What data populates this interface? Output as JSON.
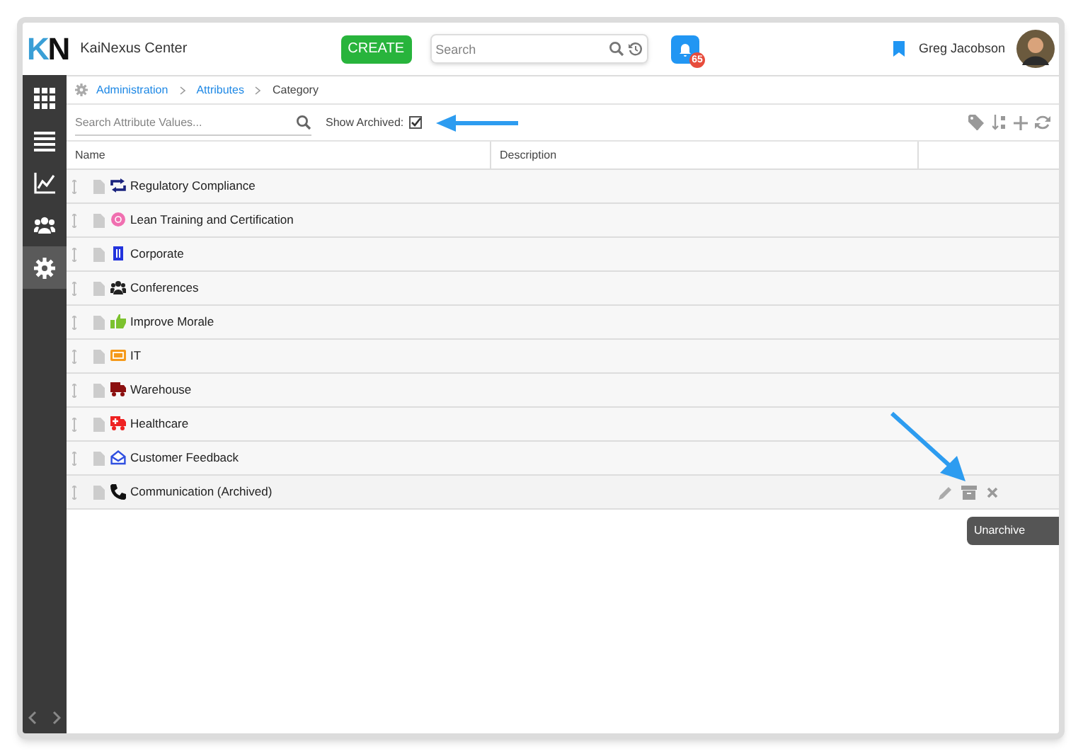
{
  "header": {
    "logo": "KN",
    "app_title": "KaiNexus Center",
    "create_button": "CREATE",
    "search": {
      "placeholder": "Search"
    },
    "notifications": {
      "count": "65"
    },
    "user_name": "Greg Jacobson"
  },
  "sidebar": {
    "items": [
      {
        "selected": false
      },
      {
        "selected": false
      },
      {
        "selected": false
      },
      {
        "selected": false
      },
      {
        "selected": true
      }
    ]
  },
  "breadcrumb": [
    {
      "label": "Administration",
      "link": true
    },
    {
      "label": "Attributes",
      "link": true
    },
    {
      "label": "Category",
      "link": false
    }
  ],
  "toolbar": {
    "search": {
      "placeholder": "Search Attribute Values..."
    },
    "show_archived": {
      "label": "Show Archived:",
      "checked": true
    }
  },
  "table": {
    "columns": [
      "Name",
      "Description",
      ""
    ],
    "rows": [
      {
        "name": "Regulatory Compliance",
        "color": "#1a237e",
        "hovered": false
      },
      {
        "name": "Lean Training and Certification",
        "color": "#f06fb0",
        "hovered": false
      },
      {
        "name": "Corporate",
        "color": "#2233dd",
        "hovered": false
      },
      {
        "name": "Conferences",
        "color": "#222222",
        "hovered": false
      },
      {
        "name": "Improve Morale",
        "color": "#7cc22e",
        "hovered": false
      },
      {
        "name": "IT",
        "color": "#f59a1b",
        "hovered": false
      },
      {
        "name": "Warehouse",
        "color": "#8b0f0f",
        "hovered": false
      },
      {
        "name": "Healthcare",
        "color": "#ee2222",
        "hovered": false
      },
      {
        "name": "Customer Feedback",
        "color": "#2f4fe0",
        "hovered": false
      },
      {
        "name": "Communication (Archived)",
        "color": "#111111",
        "hovered": true
      }
    ]
  },
  "tooltip": "Unarchive"
}
